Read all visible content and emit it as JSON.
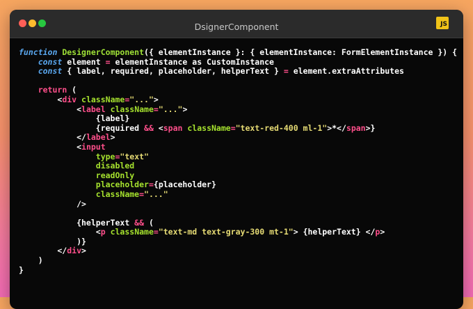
{
  "window": {
    "title": "DsignerComponent",
    "badge": "JS"
  },
  "code_lines": [
    [
      {
        "t": "function",
        "c": "kw"
      },
      {
        "t": " ",
        "c": "pl"
      },
      {
        "t": "DesignerComponent",
        "c": "fn"
      },
      {
        "t": "({ elementInstance }: { elementInstance: FormElementInstance }) {",
        "c": "pl"
      }
    ],
    [
      {
        "t": "    ",
        "c": "pl"
      },
      {
        "t": "const",
        "c": "kw"
      },
      {
        "t": " element ",
        "c": "pl"
      },
      {
        "t": "=",
        "c": "op"
      },
      {
        "t": " elementInstance as CustomInstance",
        "c": "pl"
      }
    ],
    [
      {
        "t": "    ",
        "c": "pl"
      },
      {
        "t": "const",
        "c": "kw"
      },
      {
        "t": " { label, required, placeholder, helperText } ",
        "c": "pl"
      },
      {
        "t": "=",
        "c": "op"
      },
      {
        "t": " element.extraAttributes",
        "c": "pl"
      }
    ],
    [],
    [
      {
        "t": "    ",
        "c": "pl"
      },
      {
        "t": "return",
        "c": "op"
      },
      {
        "t": " (",
        "c": "pl"
      }
    ],
    [
      {
        "t": "        <",
        "c": "pl"
      },
      {
        "t": "div",
        "c": "tag"
      },
      {
        "t": " ",
        "c": "pl"
      },
      {
        "t": "className",
        "c": "attr"
      },
      {
        "t": "=",
        "c": "op"
      },
      {
        "t": "\"...\"",
        "c": "str"
      },
      {
        "t": ">",
        "c": "pl"
      }
    ],
    [
      {
        "t": "            <",
        "c": "pl"
      },
      {
        "t": "label",
        "c": "tag"
      },
      {
        "t": " ",
        "c": "pl"
      },
      {
        "t": "className",
        "c": "attr"
      },
      {
        "t": "=",
        "c": "op"
      },
      {
        "t": "\"...\"",
        "c": "str"
      },
      {
        "t": ">",
        "c": "pl"
      }
    ],
    [
      {
        "t": "                {label}",
        "c": "pl"
      }
    ],
    [
      {
        "t": "                {required ",
        "c": "pl"
      },
      {
        "t": "&&",
        "c": "op"
      },
      {
        "t": " <",
        "c": "pl"
      },
      {
        "t": "span",
        "c": "tag"
      },
      {
        "t": " ",
        "c": "pl"
      },
      {
        "t": "className",
        "c": "attr"
      },
      {
        "t": "=",
        "c": "op"
      },
      {
        "t": "\"text-red-400 ml-1\"",
        "c": "str"
      },
      {
        "t": ">*</",
        "c": "pl"
      },
      {
        "t": "span",
        "c": "tag"
      },
      {
        "t": ">}",
        "c": "pl"
      }
    ],
    [
      {
        "t": "            </",
        "c": "pl"
      },
      {
        "t": "label",
        "c": "tag"
      },
      {
        "t": ">",
        "c": "pl"
      }
    ],
    [
      {
        "t": "            <",
        "c": "pl"
      },
      {
        "t": "input",
        "c": "tag"
      }
    ],
    [
      {
        "t": "                ",
        "c": "pl"
      },
      {
        "t": "type",
        "c": "attr"
      },
      {
        "t": "=",
        "c": "op"
      },
      {
        "t": "\"text\"",
        "c": "str"
      }
    ],
    [
      {
        "t": "                ",
        "c": "pl"
      },
      {
        "t": "disabled",
        "c": "attr"
      }
    ],
    [
      {
        "t": "                ",
        "c": "pl"
      },
      {
        "t": "readOnly",
        "c": "attr"
      }
    ],
    [
      {
        "t": "                ",
        "c": "pl"
      },
      {
        "t": "placeholder",
        "c": "attr"
      },
      {
        "t": "=",
        "c": "op"
      },
      {
        "t": "{placeholder}",
        "c": "pl"
      }
    ],
    [
      {
        "t": "                ",
        "c": "pl"
      },
      {
        "t": "className",
        "c": "attr"
      },
      {
        "t": "=",
        "c": "op"
      },
      {
        "t": "\"...\"",
        "c": "str"
      }
    ],
    [
      {
        "t": "            />",
        "c": "pl"
      }
    ],
    [],
    [
      {
        "t": "            {helperText ",
        "c": "pl"
      },
      {
        "t": "&&",
        "c": "op"
      },
      {
        "t": " (",
        "c": "pl"
      }
    ],
    [
      {
        "t": "                <",
        "c": "pl"
      },
      {
        "t": "p",
        "c": "tag"
      },
      {
        "t": " ",
        "c": "pl"
      },
      {
        "t": "className",
        "c": "attr"
      },
      {
        "t": "=",
        "c": "op"
      },
      {
        "t": "\"text-md text-gray-300 mt-1\"",
        "c": "str"
      },
      {
        "t": "> {helperText} </",
        "c": "pl"
      },
      {
        "t": "p",
        "c": "tag"
      },
      {
        "t": ">",
        "c": "pl"
      }
    ],
    [
      {
        "t": "            )}",
        "c": "pl"
      }
    ],
    [
      {
        "t": "        </",
        "c": "pl"
      },
      {
        "t": "div",
        "c": "tag"
      },
      {
        "t": ">",
        "c": "pl"
      }
    ],
    [
      {
        "t": "    )",
        "c": "pl"
      }
    ],
    [
      {
        "t": "}",
        "c": "pl"
      }
    ]
  ]
}
